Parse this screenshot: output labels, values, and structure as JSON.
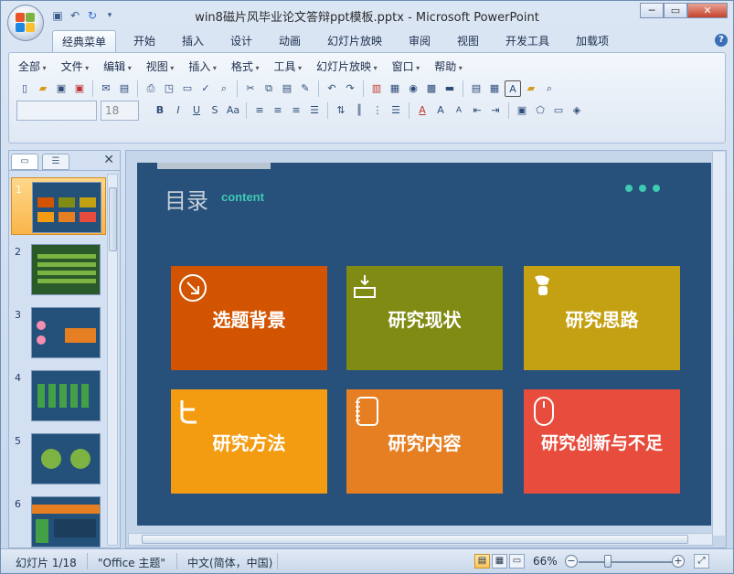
{
  "window": {
    "title": "win8磁片风毕业论文答辩ppt模板.pptx - Microsoft PowerPoint"
  },
  "ribbon_tabs": [
    "经典菜单",
    "开始",
    "插入",
    "设计",
    "动画",
    "幻灯片放映",
    "审阅",
    "视图",
    "开发工具",
    "加载项"
  ],
  "active_tab": "经典菜单",
  "classic_menus": [
    "全部",
    "文件",
    "编辑",
    "视图",
    "插入",
    "格式",
    "工具",
    "幻灯片放映",
    "窗口",
    "帮助"
  ],
  "font_size": "18",
  "slide_numbers": [
    "1",
    "2",
    "3",
    "4",
    "5",
    "6"
  ],
  "selected_slide": "1",
  "slide": {
    "title": "目录",
    "subtitle": "content",
    "cards": [
      {
        "label": "选题背景",
        "color": "#d35400",
        "icon": "arrow-circle-icon"
      },
      {
        "label": "研究现状",
        "color": "#7f8b12",
        "icon": "download-icon"
      },
      {
        "label": "研究思路",
        "color": "#c4a113",
        "icon": "lightbulb-icon"
      },
      {
        "label": "研究方法",
        "color": "#f39c12",
        "icon": "twitter-icon"
      },
      {
        "label": "研究内容",
        "color": "#e67e22",
        "icon": "notebook-icon"
      },
      {
        "label": "研究创新与不足",
        "color": "#e74c3c",
        "icon": "mouse-icon"
      }
    ],
    "background": "#27507b",
    "accent": "#3ecab3"
  },
  "status": {
    "slide_info": "幻灯片 1/18",
    "theme": "\"Office 主题\"",
    "language": "中文(简体，中国)",
    "zoom": "66%"
  }
}
